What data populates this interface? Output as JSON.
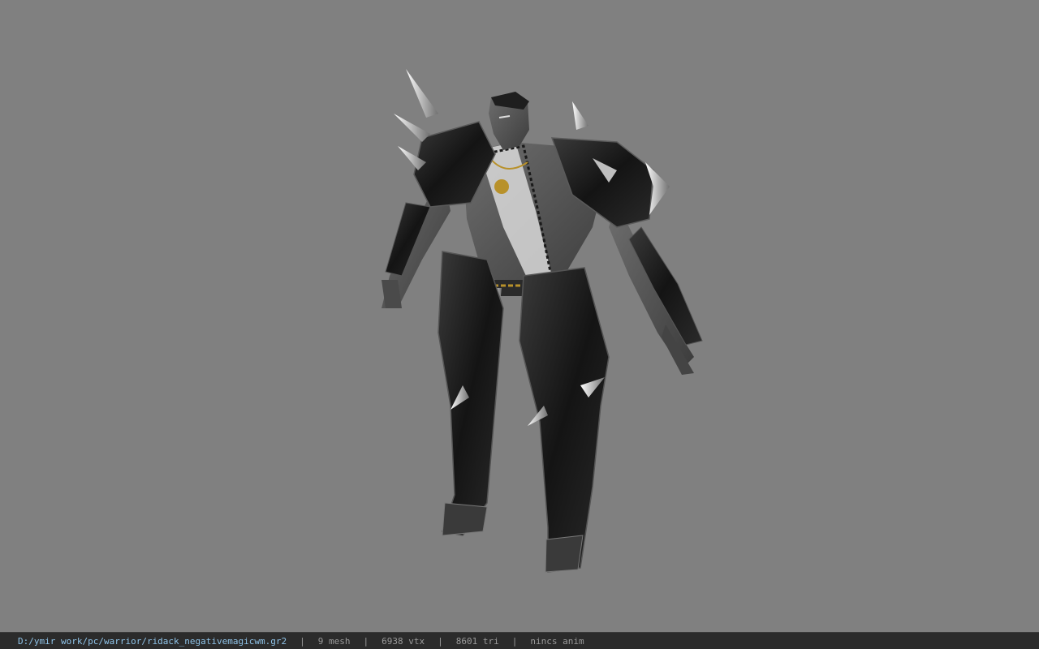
{
  "viewer": {
    "background_color": "#808080",
    "model": {
      "subject": "warrior-character-model",
      "armor_color": "#1c1c1c",
      "skin_color": "#5a5a5a",
      "accent_color": "#b8912a"
    }
  },
  "status_bar": {
    "file_path": "D:/ymir work/pc/warrior/ridack_negativemagicwm.gr2",
    "separator": "|",
    "mesh_count": "9 mesh",
    "vertex_count": "6938 vtx",
    "triangle_count": "8601 tri",
    "animation": "nincs anim",
    "path_color": "#8fc3e8"
  }
}
